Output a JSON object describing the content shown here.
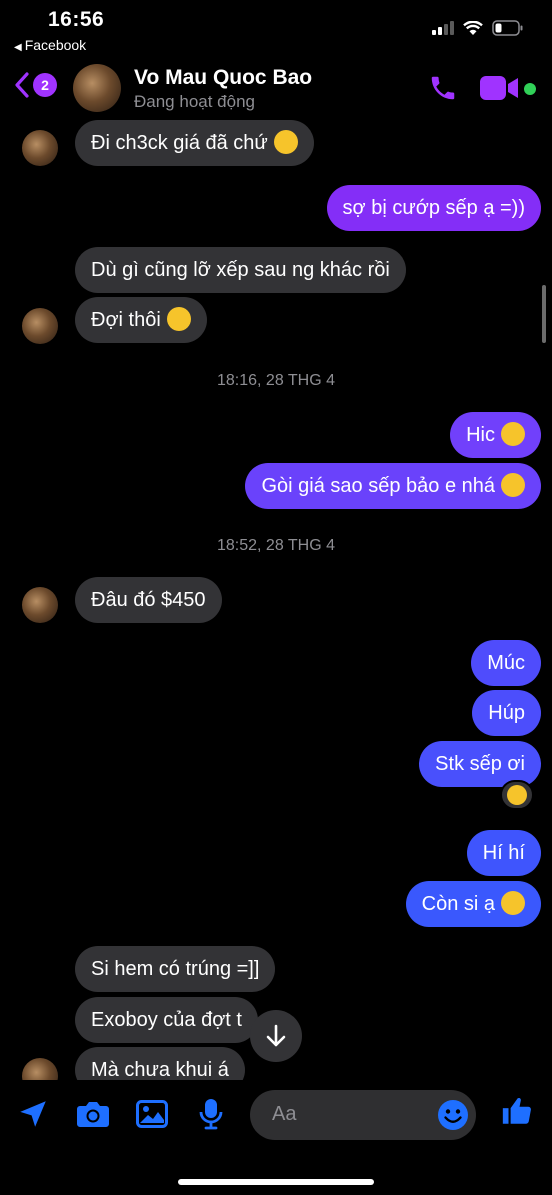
{
  "status": {
    "time": "16:56",
    "back_app": "Facebook"
  },
  "header": {
    "back_badge": "2",
    "contact_name": "Vo Mau Quoc Bao",
    "contact_status": "Đang hoạt động"
  },
  "messages": [
    {
      "side": "in",
      "text": "Đi ch3ck giá đã chứ",
      "emoji": "grinning-sweat"
    },
    {
      "side": "out",
      "text": "sợ bị cướp sếp ạ =))"
    },
    {
      "side": "in",
      "text": "Dù gì cũng lỡ xếp sau ng khác rồi"
    },
    {
      "side": "in",
      "text": "Đợi thôi",
      "emoji": "grinning-sweat"
    },
    {
      "side": "time",
      "text": "18:16, 28 THG 4"
    },
    {
      "side": "out",
      "text": "Hic",
      "emoji": "holding-tears"
    },
    {
      "side": "out",
      "text": "Gòi giá sao sếp bảo e nhá",
      "emoji": "rolling-laugh"
    },
    {
      "side": "time",
      "text": "18:52, 28 THG 4"
    },
    {
      "side": "in",
      "text": "Đâu đó $450"
    },
    {
      "side": "out",
      "text": "Múc"
    },
    {
      "side": "out",
      "text": "Húp"
    },
    {
      "side": "out",
      "text": "Stk sếp ơi",
      "reaction": "laughing"
    },
    {
      "side": "out",
      "text": "Hí hí"
    },
    {
      "side": "out",
      "text": "Còn si ạ",
      "emoji": "holding-tears"
    },
    {
      "side": "in",
      "text": "Si hem có trúng =]]"
    },
    {
      "side": "in",
      "text": "Exoboy của đợt t"
    },
    {
      "side": "in",
      "text": "Mà chưa khui á"
    }
  ],
  "composer": {
    "placeholder": "Aa"
  },
  "colors": {
    "accent": "#a033ff",
    "out_bubble_top": "#8a3dfb",
    "out_bubble_bottom": "#3a5cff",
    "in_bubble": "#333336",
    "composer_icon": "#1e6fff",
    "online": "#31d158"
  }
}
